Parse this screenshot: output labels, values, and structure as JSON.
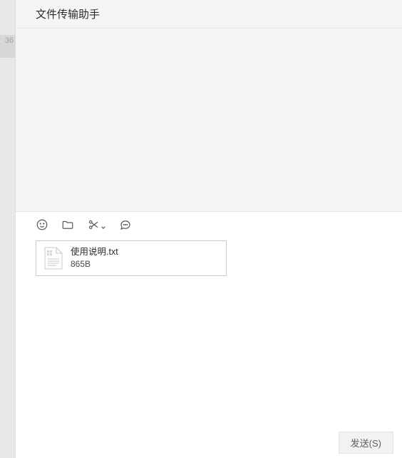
{
  "sidebar": {
    "badge": "36"
  },
  "header": {
    "title": "文件传输助手"
  },
  "toolbar": {
    "emoji_icon": "emoji",
    "folder_icon": "folder",
    "scissors_icon": "scissors",
    "chat_icon": "chat"
  },
  "attachment": {
    "filename": "使用说明.txt",
    "size": "865B"
  },
  "footer": {
    "send_label": "发送(S)"
  }
}
